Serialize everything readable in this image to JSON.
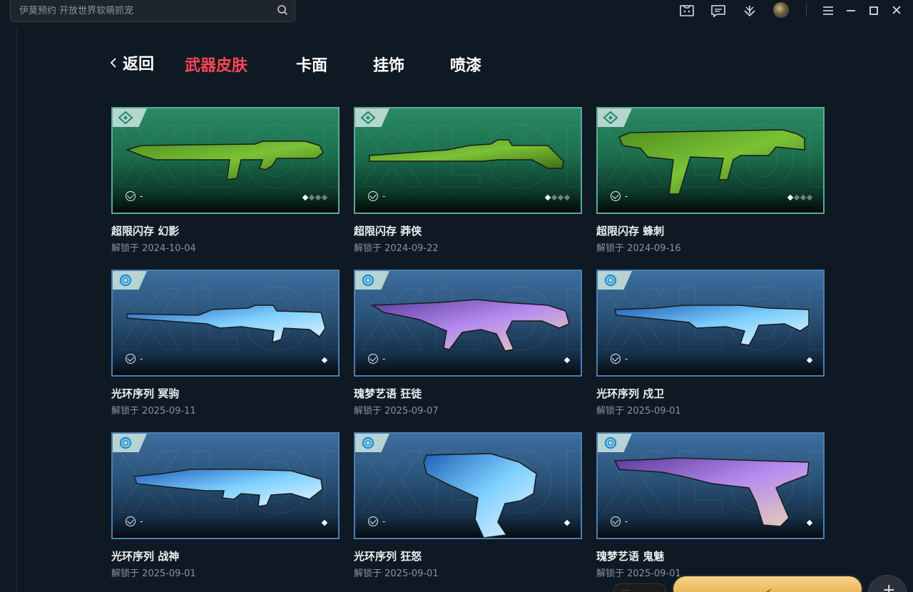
{
  "search": {
    "placeholder": "伊莫预约 开放世界软萌抓宠"
  },
  "topbar_icons": [
    "message-box-icon",
    "chat-icon",
    "download-icon",
    "avatar",
    "menu-icon",
    "minimize-icon",
    "maximize-icon",
    "close-icon"
  ],
  "nav": {
    "back_label": "返回",
    "tabs": [
      {
        "label": "武器皮肤",
        "active": true
      },
      {
        "label": "卡面",
        "active": false
      },
      {
        "label": "挂饰",
        "active": false
      },
      {
        "label": "喷漆",
        "active": false
      }
    ]
  },
  "watermark": "XLOI",
  "skins": [
    {
      "name": "超限闪存 幻影",
      "date": "解锁于 2024-10-04",
      "price": "-",
      "theme": "green",
      "levels": 4,
      "levels_unlocked": 1
    },
    {
      "name": "超限闪存 莽侠",
      "date": "解锁于 2024-09-22",
      "price": "-",
      "theme": "green",
      "levels": 4,
      "levels_unlocked": 1
    },
    {
      "name": "超限闪存 蜂刺",
      "date": "解锁于 2024-09-16",
      "price": "-",
      "theme": "green",
      "levels": 4,
      "levels_unlocked": 1
    },
    {
      "name": "光环序列 冥驹",
      "date": "解锁于 2025-09-11",
      "price": "-",
      "theme": "blue",
      "levels": 1,
      "levels_unlocked": 1
    },
    {
      "name": "瑰梦艺语 狂徒",
      "date": "解锁于 2025-09-07",
      "price": "-",
      "theme": "blue",
      "levels": 1,
      "levels_unlocked": 1
    },
    {
      "name": "光环序列 戍卫",
      "date": "解锁于 2025-09-01",
      "price": "-",
      "theme": "blue",
      "levels": 1,
      "levels_unlocked": 1
    },
    {
      "name": "光环序列 战神",
      "date": "解锁于 2025-09-01",
      "price": "-",
      "theme": "blue",
      "levels": 1,
      "levels_unlocked": 1
    },
    {
      "name": "光环序列 狂怒",
      "date": "解锁于 2025-09-01",
      "price": "-",
      "theme": "blue",
      "levels": 1,
      "levels_unlocked": 1
    },
    {
      "name": "瑰梦艺语 鬼魅",
      "date": "解锁于 2025-09-01",
      "price": "-",
      "theme": "blue",
      "levels": 1,
      "levels_unlocked": 1
    }
  ],
  "colors": {
    "accent": "#ff4655",
    "background": "#0f1923",
    "green_tier": "#2a8a63",
    "blue_tier": "#3d6e9e"
  }
}
